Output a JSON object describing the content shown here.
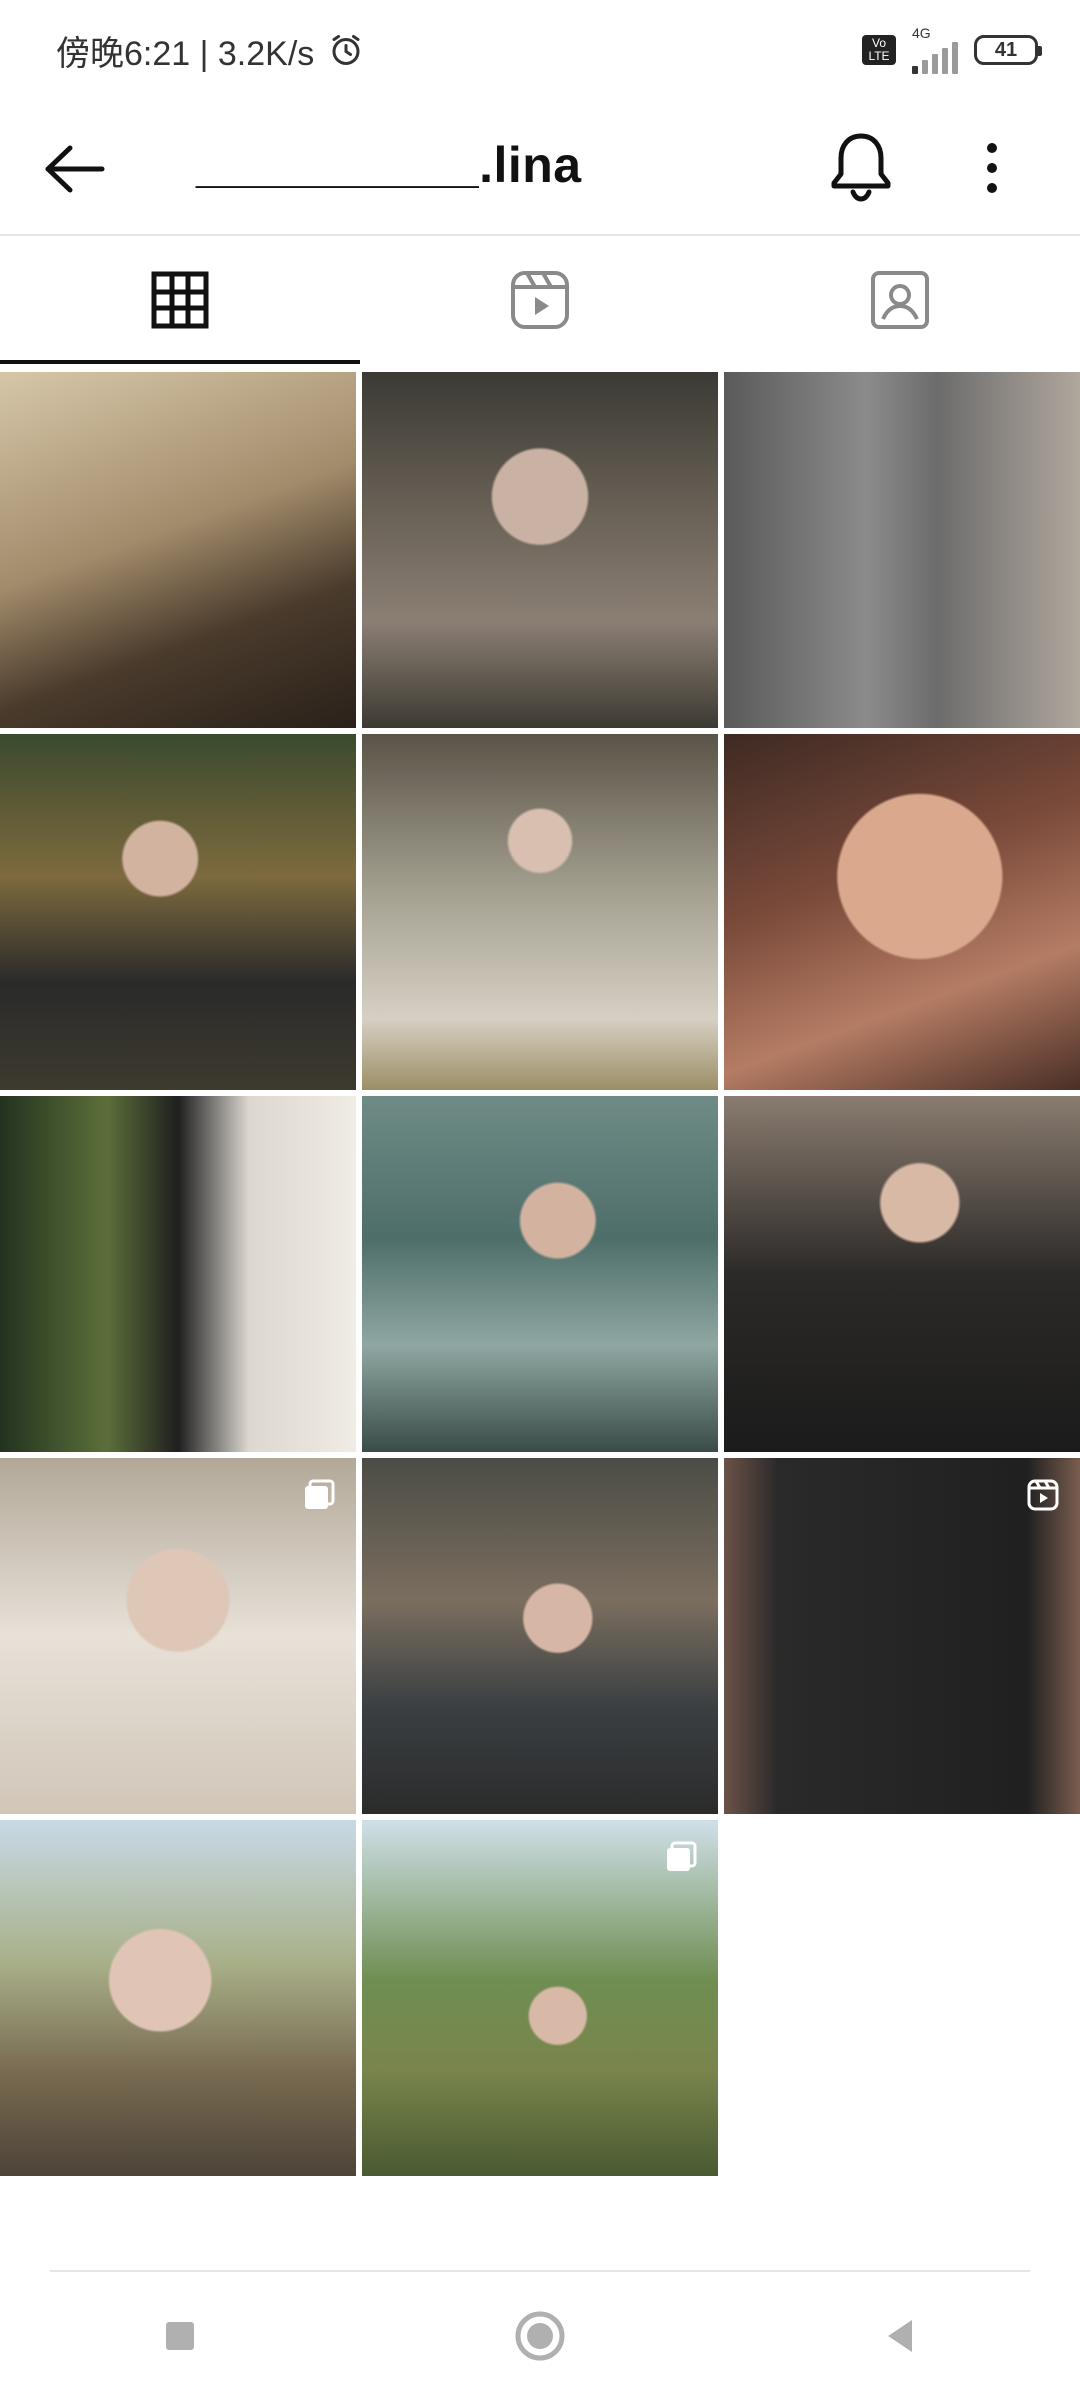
{
  "status_bar": {
    "time_text": "傍晚6:21 | 3.2K/s",
    "volte_text": "Vo LTE",
    "network_text": "4G",
    "battery_text": "41"
  },
  "header": {
    "username": "__________.lina"
  },
  "tabs": [
    {
      "name": "grid-tab",
      "icon": "grid-icon",
      "active": true
    },
    {
      "name": "reels-tab",
      "icon": "reels-icon",
      "active": false
    },
    {
      "name": "tagged-tab",
      "icon": "tagged-person-icon",
      "active": false
    }
  ],
  "grid": {
    "tile_count": 14,
    "badges": [
      {
        "tile": 10,
        "type": "multi-photo-icon"
      },
      {
        "tile": 12,
        "type": "reel-icon"
      },
      {
        "tile": 14,
        "type": "multi-photo-icon"
      }
    ]
  },
  "colors": {
    "background": "#ffffff",
    "active_tab_underline": "#111111",
    "divider": "#e6e6e6"
  }
}
